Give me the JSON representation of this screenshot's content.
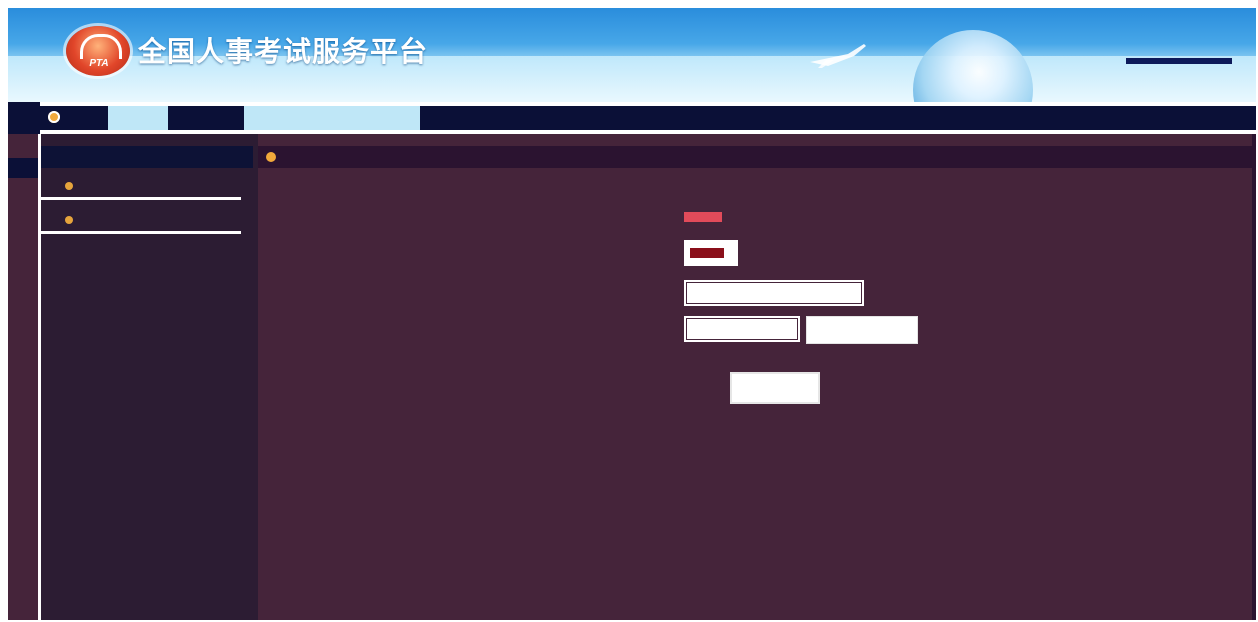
{
  "banner": {
    "title": "全国人事考试服务平台",
    "logo_text": "PTA",
    "subtitle": "",
    "colors": {
      "sky": "#2a8ddc",
      "highlight": "#d9f2fb"
    }
  },
  "topbar": {
    "items": [
      {
        "label": ""
      },
      {
        "label": ""
      },
      {
        "label": ""
      }
    ]
  },
  "sidebar": {
    "header": "",
    "items": [
      {
        "label": ""
      },
      {
        "label": ""
      }
    ]
  },
  "content": {
    "breadcrumb": "",
    "form": {
      "rows": [
        {
          "label": ""
        },
        {
          "label": ""
        },
        {
          "label": ""
        },
        {
          "label": ""
        }
      ],
      "captcha_button": "",
      "submit_button": ""
    }
  },
  "colors": {
    "page_bg": "#45243a",
    "sidebar_bg": "#2c1c33",
    "nav_bg": "#0b1037",
    "active_tab": "#bfe7f7",
    "required": "#e24b5a",
    "accent_dot": "#f2a93b"
  }
}
